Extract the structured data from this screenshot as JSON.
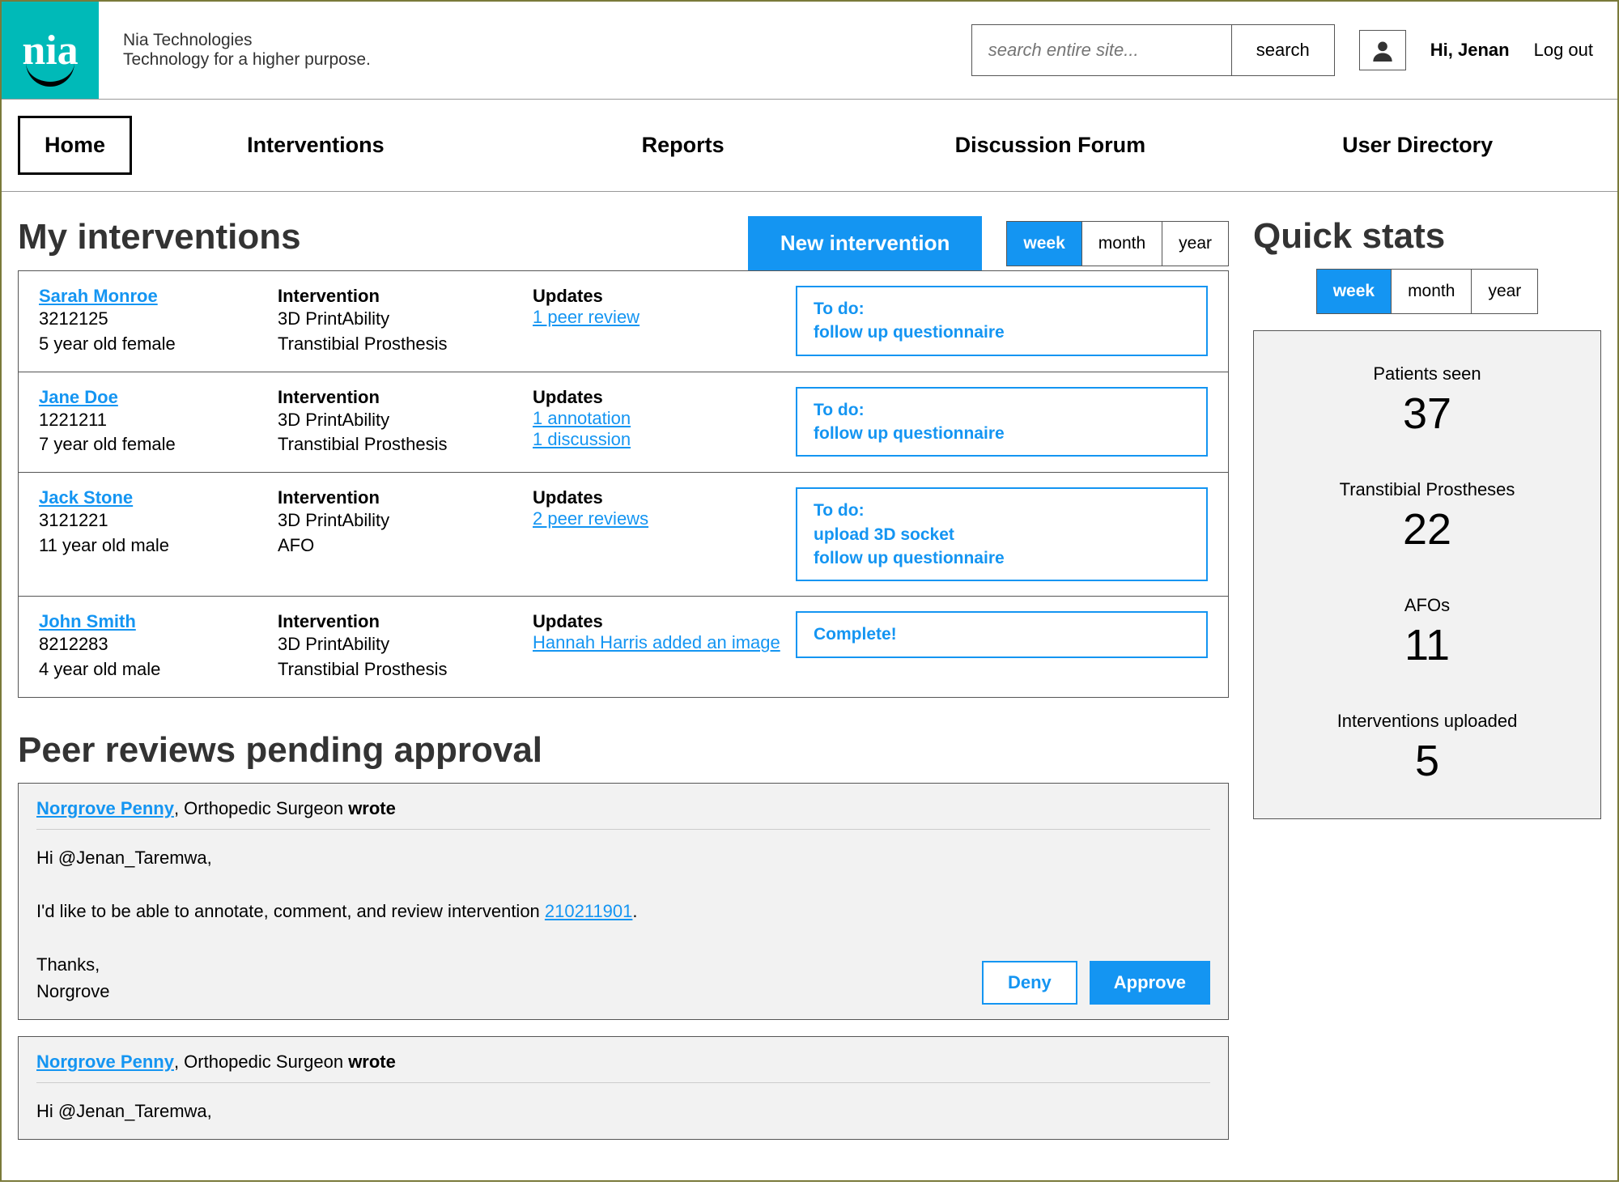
{
  "brand": {
    "name": "Nia Technologies",
    "tagline": "Technology for a higher purpose.",
    "logo_text": "nia"
  },
  "header": {
    "search_placeholder": "search entire site...",
    "search_button": "search",
    "greeting": "Hi, Jenan",
    "logout": "Log out"
  },
  "nav": [
    "Home",
    "Interventions",
    "Reports",
    "Discussion Forum",
    "User Directory"
  ],
  "main": {
    "title": "My interventions",
    "new_button": "New intervention",
    "range": [
      "week",
      "month",
      "year"
    ]
  },
  "interventions": [
    {
      "name": "Sarah Monroe",
      "id": "3212125",
      "demo": "5 year old female",
      "int_label": "Intervention",
      "int_line1": "3D PrintAbility",
      "int_line2": "Transtibial Prosthesis",
      "upd_label": "Updates",
      "upd_links": [
        "1 peer review"
      ],
      "todo_label": "To do:",
      "todo_lines": [
        "follow up questionnaire"
      ]
    },
    {
      "name": "Jane Doe",
      "id": "1221211",
      "demo": "7 year old female",
      "int_label": "Intervention",
      "int_line1": "3D PrintAbility",
      "int_line2": "Transtibial Prosthesis",
      "upd_label": "Updates",
      "upd_links": [
        "1 annotation",
        "1 discussion"
      ],
      "todo_label": "To do:",
      "todo_lines": [
        "follow up questionnaire"
      ]
    },
    {
      "name": "Jack Stone",
      "id": "3121221",
      "demo": "11 year old male",
      "int_label": "Intervention",
      "int_line1": "3D PrintAbility",
      "int_line2": "AFO",
      "upd_label": "Updates",
      "upd_links": [
        "2 peer reviews"
      ],
      "todo_label": "To do:",
      "todo_lines": [
        "upload 3D socket",
        "follow up questionnaire"
      ]
    },
    {
      "name": "John Smith",
      "id": "8212283",
      "demo": "4 year old male",
      "int_label": "Intervention",
      "int_line1": "3D PrintAbility",
      "int_line2": "Transtibial Prosthesis",
      "upd_label": "Updates",
      "upd_links": [
        "Hannah Harris added an image"
      ],
      "todo_label": "",
      "todo_lines": [
        "Complete!"
      ]
    }
  ],
  "peer": {
    "title": "Peer reviews pending approval",
    "reviews": [
      {
        "author": "Norgrove Penny",
        "role": ", Orthopedic Surgeon ",
        "wrote": "wrote",
        "body_pre": "Hi @Jenan_Taremwa,\n\nI'd like to be able to annotate, comment, and review intervention ",
        "link": "210211901",
        "body_post": ".\n\nThanks,\nNorgrove",
        "deny": "Deny",
        "approve": "Approve"
      },
      {
        "author": "Norgrove Penny",
        "role": ", Orthopedic Surgeon ",
        "wrote": "wrote",
        "body_pre": "Hi @Jenan_Taremwa,",
        "link": "",
        "body_post": "",
        "deny": "",
        "approve": ""
      }
    ]
  },
  "stats": {
    "title": "Quick stats",
    "range": [
      "week",
      "month",
      "year"
    ],
    "items": [
      {
        "label": "Patients seen",
        "value": "37"
      },
      {
        "label": "Transtibial Prostheses",
        "value": "22"
      },
      {
        "label": "AFOs",
        "value": "11"
      },
      {
        "label": "Interventions uploaded",
        "value": "5"
      }
    ]
  }
}
